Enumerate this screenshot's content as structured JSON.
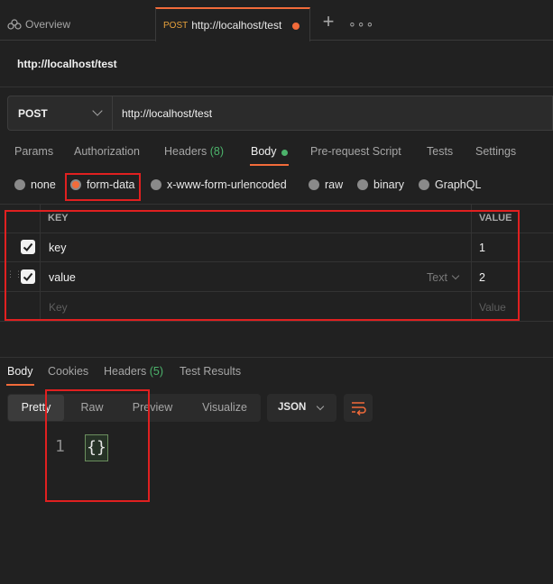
{
  "tabs": {
    "overview_label": "Overview",
    "active_method": "POST",
    "active_url": "http://localhost/test",
    "plus": "+",
    "more": "∘∘∘"
  },
  "request": {
    "title": "http://localhost/test",
    "method": "POST",
    "url": "http://localhost/test"
  },
  "request_tabs": {
    "params": "Params",
    "authorization": "Authorization",
    "headers": "Headers",
    "headers_count": "(8)",
    "body": "Body",
    "prerequest": "Pre-request Script",
    "tests": "Tests",
    "settings": "Settings"
  },
  "body_types": {
    "none": "none",
    "form_data": "form-data",
    "urlencoded": "x-www-form-urlencoded",
    "raw": "raw",
    "binary": "binary",
    "graphql": "GraphQL"
  },
  "table": {
    "key_header": "KEY",
    "value_header": "VALUE",
    "rows": [
      {
        "key": "key",
        "value": "1",
        "checked": true
      },
      {
        "key": "value",
        "value": "2",
        "checked": true,
        "type": "Text"
      }
    ],
    "key_placeholder": "Key",
    "value_placeholder": "Value"
  },
  "response_tabs": {
    "body": "Body",
    "cookies": "Cookies",
    "headers": "Headers",
    "headers_count": "(5)",
    "test_results": "Test Results"
  },
  "view_modes": {
    "pretty": "Pretty",
    "raw": "Raw",
    "preview": "Preview",
    "visualize": "Visualize"
  },
  "format": "JSON",
  "response_body": {
    "line_number": "1",
    "content": "{}"
  },
  "colors": {
    "accent": "#f26b3a",
    "success": "#4cb36b",
    "annotation": "#e02020"
  }
}
